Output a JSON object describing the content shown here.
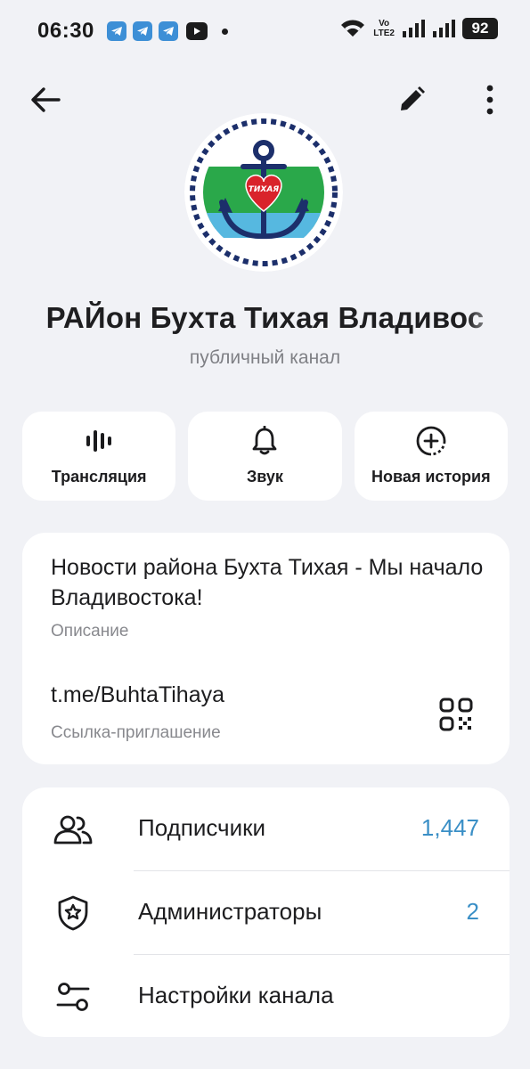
{
  "status_bar": {
    "time": "06:30",
    "network_label_top": "Vo",
    "network_label_bottom": "LTE2",
    "battery": "92",
    "notification_icons": [
      "telegram-icon",
      "telegram-icon",
      "telegram-icon",
      "youtube-icon"
    ]
  },
  "channel": {
    "title": "РАЙон Бухта Тихая Владивос",
    "subtitle": "публичный канал",
    "avatar_text": "ТИХАЯ"
  },
  "actions": [
    {
      "label": "Трансляция",
      "icon": "livestream-icon"
    },
    {
      "label": "Звук",
      "icon": "bell-icon"
    },
    {
      "label": "Новая история",
      "icon": "new-story-icon"
    }
  ],
  "info": {
    "description": "Новости района Бухта Тихая - Мы начало Владивостока!",
    "description_label": "Описание",
    "link": "t.me/BuhtaTihaya",
    "link_label": "Ссылка-приглашение"
  },
  "menu": [
    {
      "label": "Подписчики",
      "value": "1,447",
      "icon": "subscribers-icon"
    },
    {
      "label": "Администраторы",
      "value": "2",
      "icon": "admin-shield-icon"
    },
    {
      "label": "Настройки канала",
      "value": "",
      "icon": "settings-sliders-icon"
    }
  ],
  "colors": {
    "background": "#f1f2f6",
    "card": "#ffffff",
    "accent_value": "#3a8fc6",
    "telegram_blue": "#3d8fd6"
  }
}
